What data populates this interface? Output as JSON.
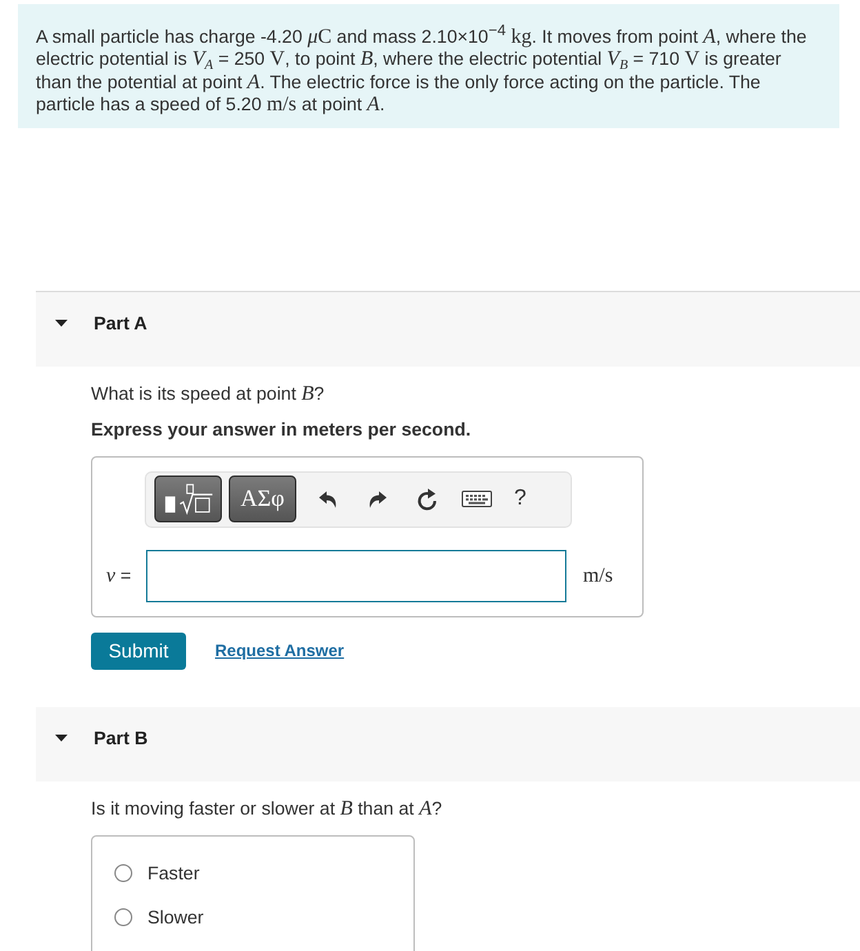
{
  "problem": {
    "segments": [
      {
        "kind": "text",
        "text": "A small particle has charge -4.20 "
      },
      {
        "kind": "var",
        "text": "μ"
      },
      {
        "kind": "unit",
        "text": "C"
      },
      {
        "kind": "text",
        "text": " and mass 2.10×10$^{−4}$ "
      },
      {
        "kind": "unit",
        "text": "kg"
      },
      {
        "kind": "text",
        "text": ". It moves from point "
      },
      {
        "kind": "var",
        "text": "A"
      },
      {
        "kind": "text",
        "text": ", where the electric potential is "
      },
      {
        "kind": "var",
        "text": "V$_{A}$"
      },
      {
        "kind": "text",
        "text": " = 250 "
      },
      {
        "kind": "unit",
        "text": "V"
      },
      {
        "kind": "text",
        "text": ", to point "
      },
      {
        "kind": "var",
        "text": "B"
      },
      {
        "kind": "text",
        "text": ", where the electric potential "
      },
      {
        "kind": "var",
        "text": "V$_{B}$"
      },
      {
        "kind": "text",
        "text": " = 710 "
      },
      {
        "kind": "unit",
        "text": "V"
      },
      {
        "kind": "text",
        "text": " is greater than the potential at point "
      },
      {
        "kind": "var",
        "text": "A"
      },
      {
        "kind": "text",
        "text": ". The electric force is the only force acting on the particle. The particle has a speed of 5.20 "
      },
      {
        "kind": "unit",
        "text": "m/s"
      },
      {
        "kind": "text",
        "text": " at point "
      },
      {
        "kind": "var",
        "text": "A"
      },
      {
        "kind": "text",
        "text": "."
      }
    ]
  },
  "parts": [
    {
      "title": "Part A",
      "expanded": true,
      "kind": "numeric",
      "question": [
        {
          "kind": "text",
          "text": "What is its speed at point "
        },
        {
          "kind": "var",
          "text": "B"
        },
        {
          "kind": "text",
          "text": "?"
        }
      ],
      "instruction": "Express your answer in meters per second.",
      "toolbar": {
        "symbols_label": "ΑΣφ",
        "help_label": "?"
      },
      "answer": {
        "label": [
          {
            "kind": "var",
            "text": "v"
          },
          {
            "kind": "text",
            "text": " ="
          }
        ],
        "unit": [
          {
            "kind": "unit",
            "text": "m/s"
          }
        ]
      },
      "submit_label": "Submit",
      "request_label": "Request Answer"
    },
    {
      "title": "Part B",
      "expanded": true,
      "kind": "choice",
      "question": [
        {
          "kind": "text",
          "text": "Is it moving faster or slower at "
        },
        {
          "kind": "var",
          "text": "B"
        },
        {
          "kind": "text",
          "text": " than at "
        },
        {
          "kind": "var",
          "text": "A"
        },
        {
          "kind": "text",
          "text": "?"
        }
      ],
      "options": [
        {
          "label": "Faster",
          "selected": false
        },
        {
          "label": "Slower",
          "selected": false
        }
      ]
    }
  ]
}
